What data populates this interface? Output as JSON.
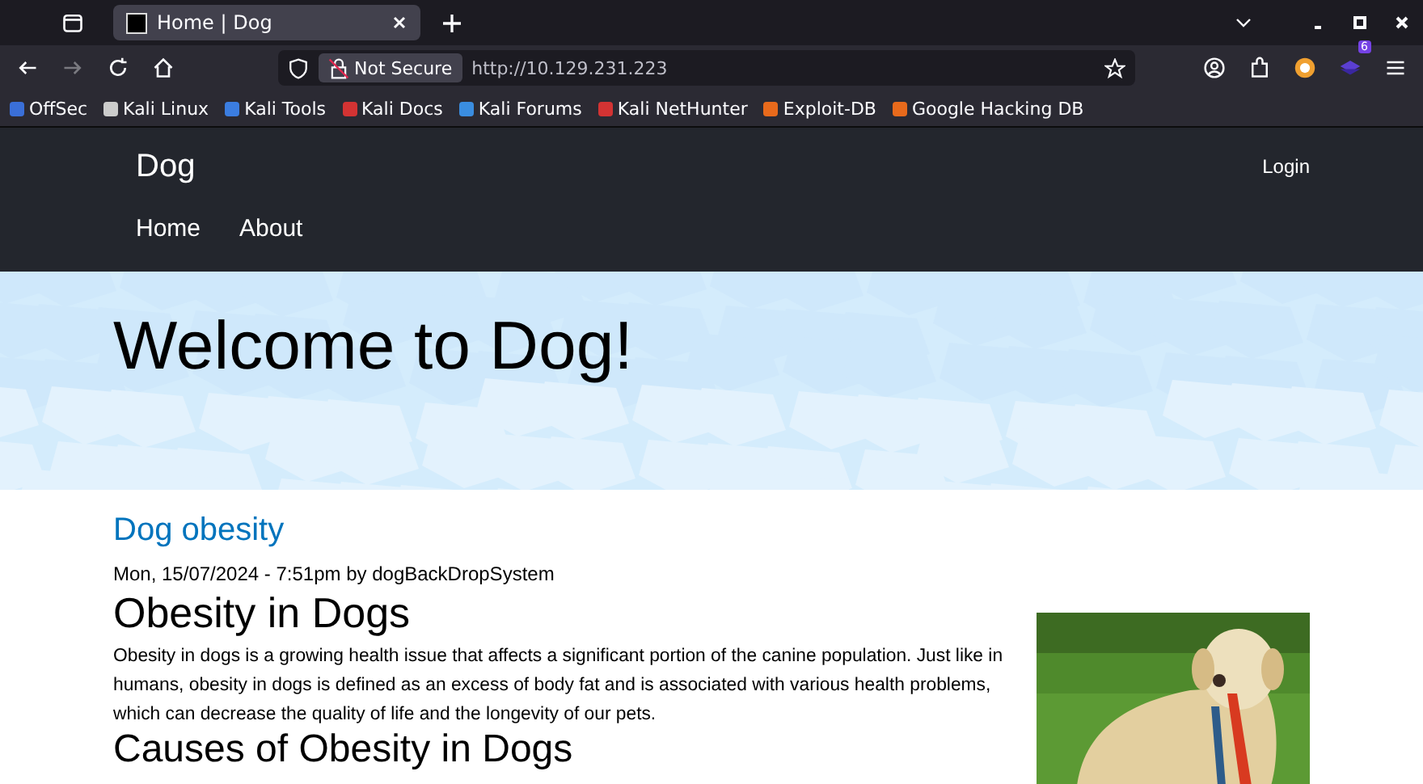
{
  "browser": {
    "tab": {
      "title": "Home | Dog",
      "selected": true
    },
    "address": {
      "security": "Not Secure",
      "url": "http://10.129.231.223"
    },
    "extension_badge": "6",
    "bookmarks": [
      {
        "label": "OffSec",
        "color": "#3a6fd8"
      },
      {
        "label": "Kali Linux",
        "color": "#cccccc"
      },
      {
        "label": "Kali Tools",
        "color": "#3b7de0"
      },
      {
        "label": "Kali Docs",
        "color": "#d33333"
      },
      {
        "label": "Kali Forums",
        "color": "#3a8de0"
      },
      {
        "label": "Kali NetHunter",
        "color": "#d33333"
      },
      {
        "label": "Exploit-DB",
        "color": "#e86a1c"
      },
      {
        "label": "Google Hacking DB",
        "color": "#e86a1c"
      }
    ]
  },
  "site": {
    "name": "Dog",
    "login": "Login",
    "nav": [
      "Home",
      "About"
    ],
    "hero_title": "Welcome to Dog!",
    "article": {
      "title": "Dog obesity",
      "meta": "Mon, 15/07/2024 - 7:51pm by dogBackDropSystem",
      "heading": "Obesity in Dogs",
      "paragraph": "Obesity in dogs is a growing health issue that affects a significant portion of the canine population. Just like in humans, obesity in dogs is defined as an excess of body fat and is associated with various health problems, which can decrease the quality of life and the longevity of our pets.",
      "next_heading": "Causes of Obesity in Dogs"
    }
  }
}
